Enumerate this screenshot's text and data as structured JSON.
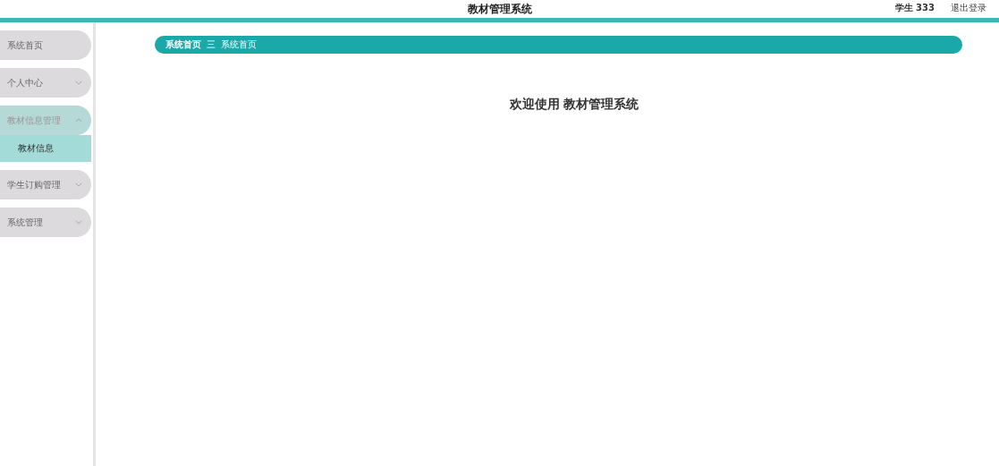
{
  "header": {
    "title": "教材管理系统",
    "user": "学生 333",
    "logout": "退出登录"
  },
  "sidebar": {
    "items": [
      {
        "label": "系统首页",
        "has_children": false,
        "expanded": false
      },
      {
        "label": "个人中心",
        "has_children": true,
        "expanded": false
      },
      {
        "label": "教材信息管理",
        "has_children": true,
        "expanded": true,
        "children": [
          {
            "label": "教材信息",
            "selected": true
          }
        ]
      },
      {
        "label": "学生订购管理",
        "has_children": true,
        "expanded": false
      },
      {
        "label": "系统管理",
        "has_children": true,
        "expanded": false
      }
    ]
  },
  "breadcrumb": {
    "items": [
      "系统首页",
      "系统首页"
    ],
    "separator": "三"
  },
  "welcome": "欢迎使用 教材管理系统"
}
